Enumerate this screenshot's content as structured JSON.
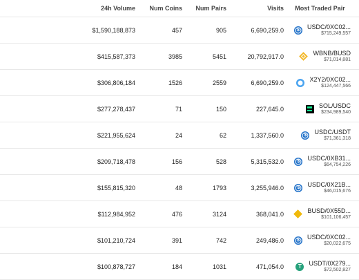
{
  "headers": {
    "volume": "24h Volume",
    "coins": "Num Coins",
    "pairs": "Num Pairs",
    "visits": "Visits",
    "pair": "Most Traded Pair"
  },
  "rows": [
    {
      "volume": "$1,590,188,873",
      "coins": "457",
      "pairs": "905",
      "visits": "6,690,259.0",
      "pair": "USDC/0XC02...",
      "pair_volume": "$715,249,557",
      "icon": "usdc-icon"
    },
    {
      "volume": "$415,587,373",
      "coins": "3985",
      "pairs": "5451",
      "visits": "20,792,917.0",
      "pair": "WBNB/BUSD",
      "pair_volume": "$71,014,881",
      "icon": "bnb-icon"
    },
    {
      "volume": "$306,806,184",
      "coins": "1526",
      "pairs": "2559",
      "visits": "6,690,259.0",
      "pair": "X2Y2/0XC02...",
      "pair_volume": "$124,447,566",
      "icon": "x2y2-icon"
    },
    {
      "volume": "$277,278,437",
      "coins": "71",
      "pairs": "150",
      "visits": "227,645.0",
      "pair": "SOL/USDC",
      "pair_volume": "$234,989,540",
      "icon": "sol-icon"
    },
    {
      "volume": "$221,955,624",
      "coins": "24",
      "pairs": "62",
      "visits": "1,337,560.0",
      "pair": "USDC/USDT",
      "pair_volume": "$71,361,318",
      "icon": "usdc-icon"
    },
    {
      "volume": "$209,718,478",
      "coins": "156",
      "pairs": "528",
      "visits": "5,315,532.0",
      "pair": "USDC/0XB31...",
      "pair_volume": "$64,754,226",
      "icon": "usdc-icon"
    },
    {
      "volume": "$155,815,320",
      "coins": "48",
      "pairs": "1793",
      "visits": "3,255,946.0",
      "pair": "USDC/0X21B...",
      "pair_volume": "$46,015,676",
      "icon": "usdc-icon"
    },
    {
      "volume": "$112,984,952",
      "coins": "476",
      "pairs": "3124",
      "visits": "368,041.0",
      "pair": "BUSD/0X55D...",
      "pair_volume": "$101,106,457",
      "icon": "busd-icon"
    },
    {
      "volume": "$101,210,724",
      "coins": "391",
      "pairs": "742",
      "visits": "249,486.0",
      "pair": "USDC/0XC02...",
      "pair_volume": "$20,022,675",
      "icon": "usdc-icon"
    },
    {
      "volume": "$100,878,727",
      "coins": "184",
      "pairs": "1031",
      "visits": "471,054.0",
      "pair": "USDT/0X279...",
      "pair_volume": "$72,502,827",
      "icon": "usdt-icon"
    }
  ]
}
